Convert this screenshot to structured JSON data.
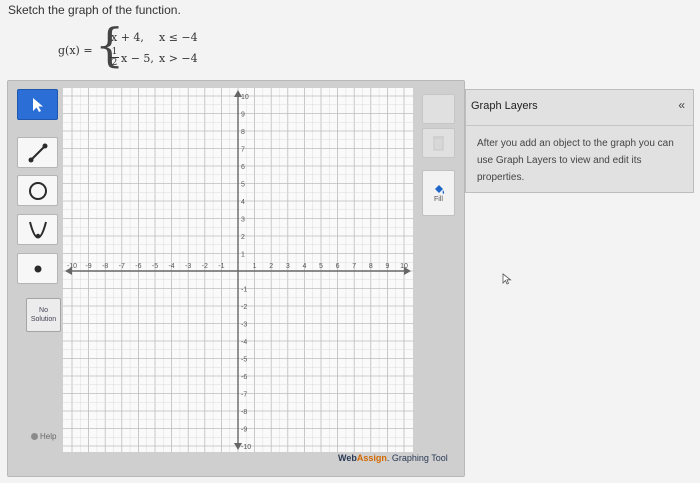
{
  "prompt": "Sketch the graph of the function.",
  "function": {
    "label": "g(x) =",
    "brace": "{",
    "piece1_expr": "x + 4,",
    "piece1_cond": "x ≤ −4",
    "piece2_frac_num": "1",
    "piece2_frac_den": "2",
    "piece2_expr": "x − 5,",
    "piece2_cond": "x > −4"
  },
  "toolbar": {
    "tools": [
      {
        "name": "pointer-tool",
        "icon": "pointer-icon",
        "active": true
      },
      {
        "name": "line-tool",
        "icon": "line-segment-icon",
        "active": false
      },
      {
        "name": "circle-tool",
        "icon": "circle-icon",
        "active": false
      },
      {
        "name": "parabola-tool",
        "icon": "parabola-icon",
        "active": false
      },
      {
        "name": "point-tool",
        "icon": "point-icon",
        "active": false
      }
    ],
    "no_solution_line1": "No",
    "no_solution_line2": "Solution",
    "help_label": "Help"
  },
  "graph": {
    "x_min": -10,
    "x_max": 10,
    "y_min": -10,
    "y_max": 10,
    "x_ticks": [
      "-10",
      "-9",
      "-8",
      "-7",
      "-6",
      "-5",
      "-4",
      "-3",
      "-2",
      "-1",
      "1",
      "2",
      "3",
      "4",
      "5",
      "6",
      "7",
      "8",
      "9",
      "10"
    ],
    "y_ticks": [
      "10",
      "9",
      "8",
      "7",
      "6",
      "5",
      "4",
      "3",
      "2",
      "1",
      "-1",
      "-2",
      "-3",
      "-4",
      "-5",
      "-6",
      "-7",
      "-8",
      "-9",
      "-10"
    ],
    "grid": true
  },
  "side_tools": {
    "fill_label": "Fill",
    "fill_icon": "paint-bucket-icon",
    "delete_icon": "trash-icon"
  },
  "brand": {
    "part1": "Web",
    "part2": "Assign",
    "part3": ". Graphing Tool"
  },
  "layers": {
    "title": "Graph Layers",
    "collapse_icon": "«",
    "description": "After you add an object to the graph you can use Graph Layers to view and edit its properties."
  },
  "colors": {
    "accent": "#2b6fd6",
    "brand_orange": "#d46a00",
    "axis": "#666666",
    "grid": "#bcbcbc"
  }
}
